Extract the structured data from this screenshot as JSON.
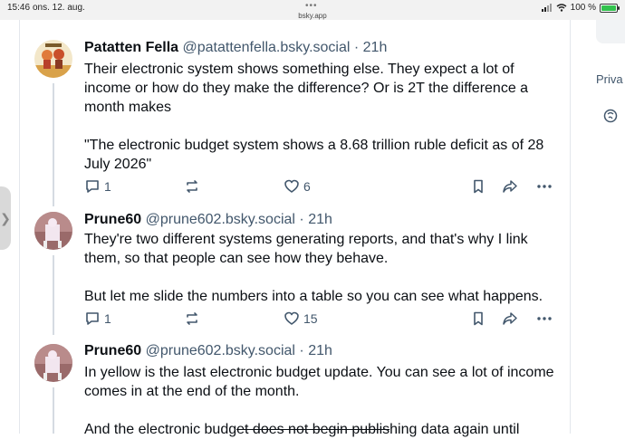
{
  "status_bar": {
    "time": "15:46",
    "date": "ons. 12. aug.",
    "url": "bsky.app",
    "battery": "100 %"
  },
  "sidebar": {
    "privacy_link": "Priva"
  },
  "posts": [
    {
      "author_name": "Patatten Fella",
      "handle": "@patattenfella.bsky.social",
      "separator": "·",
      "time": "21h",
      "paragraphs": [
        "Their electronic system shows something else. They expect a lot of income or how do they make the difference? Or is 2T the difference a month makes",
        "\"The electronic budget system shows a 8.68 trillion ruble deficit as of 28 July 2026\""
      ],
      "reply_count": "1",
      "like_count": "6"
    },
    {
      "author_name": "Prune60",
      "handle": "@prune602.bsky.social",
      "separator": "·",
      "time": "21h",
      "paragraphs": [
        "They're two different systems generating reports, and that's why I link them, so that people can see how they behave.",
        "But let me slide the numbers into a table so you can see what happens."
      ],
      "reply_count": "1",
      "like_count": "15"
    },
    {
      "author_name": "Prune60",
      "handle": "@prune602.bsky.social",
      "separator": "·",
      "time": "21h",
      "paragraphs": [
        "In yellow is the last electronic budget update.  You can see a lot of income comes in at the end of the month."
      ],
      "partial_line_start": "And the electronic budg",
      "partial_line_struck": "et does not begin publis",
      "partial_line_end": "hing data again until"
    }
  ],
  "colors": {
    "text_primary": "#0b0f14",
    "text_secondary": "#42576c",
    "border": "#e3e7ec",
    "thread_line": "#d5dbe2"
  }
}
